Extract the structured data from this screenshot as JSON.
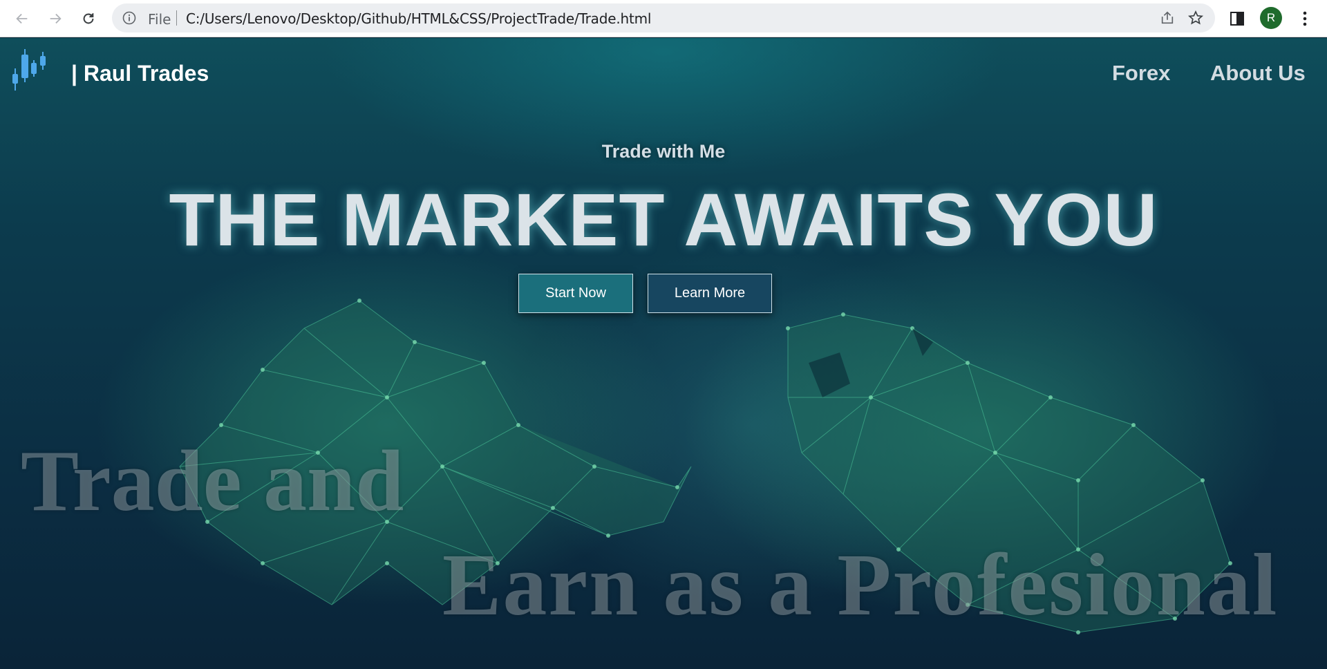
{
  "browser": {
    "scheme_label": "File",
    "url": "C:/Users/Lenovo/Desktop/Github/HTML&CSS/ProjectTrade/Trade.html",
    "profile_initial": "R",
    "profile_color": "#1f6b2c"
  },
  "header": {
    "brand": "| Raul Trades",
    "nav": [
      "Forex",
      "About Us"
    ]
  },
  "hero": {
    "kicker": "Trade with Me",
    "headline": "THE MARKET AWAITS YOU",
    "buttons": [
      "Start Now",
      "Learn More"
    ],
    "background_text": [
      "Trade and",
      "Earn as a Profesional"
    ]
  },
  "colors": {
    "accent_start": "#1b6f7c",
    "accent_learn": "#174660",
    "network_green": "#3fb98a",
    "logo_blue": "#3fa0e6"
  }
}
